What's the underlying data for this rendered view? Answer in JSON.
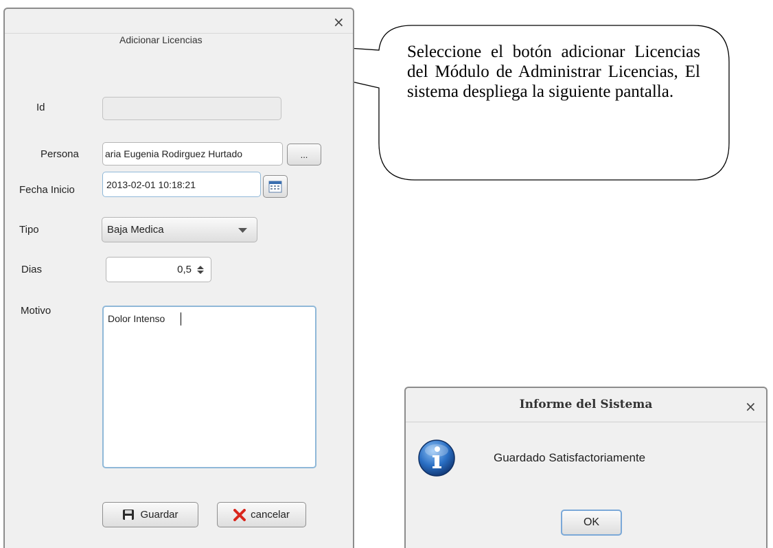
{
  "main_dialog": {
    "close_glyph": "×",
    "heading": "Adicionar Licencias",
    "fields": {
      "id": {
        "label": "Id",
        "value": ""
      },
      "persona": {
        "label": "Persona",
        "value": "aria Eugenia Rodirguez Hurtado",
        "browse_label": "..."
      },
      "fecha_inicio": {
        "label": "Fecha Inicio",
        "value": "2013-02-01 10:18:21"
      },
      "tipo": {
        "label": "Tipo",
        "value": "Baja Medica"
      },
      "dias": {
        "label": "Dias",
        "value": "0,5"
      },
      "motivo": {
        "label": "Motivo",
        "value": "Dolor Intenso"
      }
    },
    "buttons": {
      "save_label": "Guardar",
      "cancel_label": "cancelar"
    },
    "icons": {
      "calendar": "calendar-icon",
      "dropdown": "chevron-down-icon",
      "spinner": "spinner-arrows-icon",
      "save": "floppy-disk-icon",
      "cancel": "red-x-icon"
    }
  },
  "callout": {
    "text": "Seleccione el botón adicionar Licencias del Módulo de Administrar Licencias, El sistema despliega la siguiente pantalla."
  },
  "message_box": {
    "title": "Informe del Sistema",
    "close_glyph": "×",
    "message": "Guardado Satisfactoriamente",
    "ok_label": "OK",
    "icon": "info-icon"
  },
  "colors": {
    "dialog_bg": "#f0f0f0",
    "focus_border": "#8fb8d8",
    "info_blue": "#1f5fae",
    "cancel_red": "#d9261c"
  }
}
